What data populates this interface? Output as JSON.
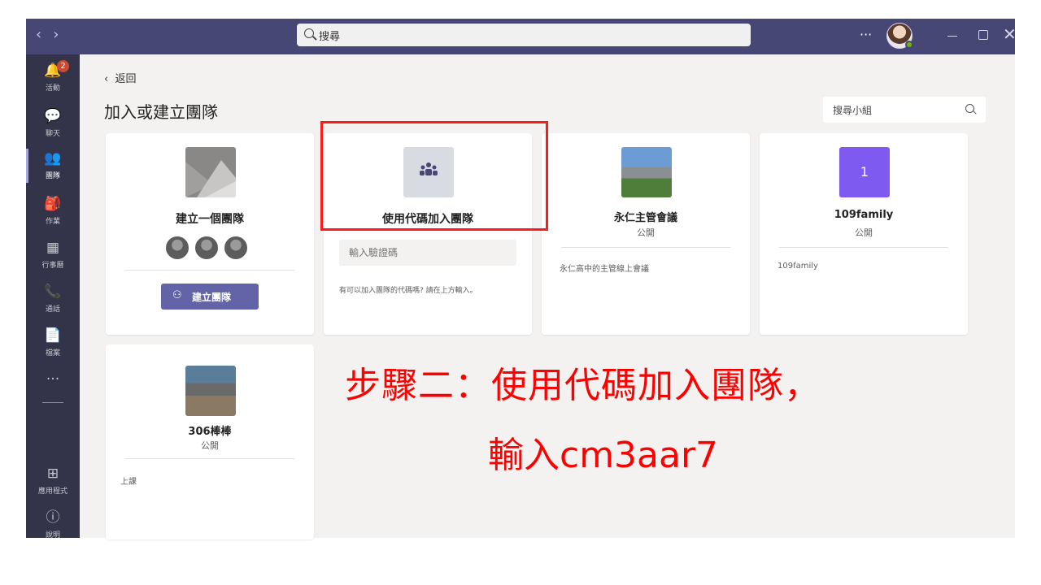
{
  "titlebar": {
    "search_text": "搜尋",
    "more_label": "···"
  },
  "rail": {
    "items": [
      {
        "label": "活動",
        "icon": "bell-icon",
        "badge": "2"
      },
      {
        "label": "聊天",
        "icon": "chat-icon"
      },
      {
        "label": "團隊",
        "icon": "teams-icon",
        "active": true
      },
      {
        "label": "作業",
        "icon": "assignments-icon"
      },
      {
        "label": "行事曆",
        "icon": "calendar-icon"
      },
      {
        "label": "通話",
        "icon": "phone-icon"
      },
      {
        "label": "檔案",
        "icon": "file-icon"
      }
    ],
    "more_label": "···",
    "apps_label": "應用程式",
    "help_label": "說明"
  },
  "page": {
    "back_label": "返回",
    "title": "加入或建立團隊",
    "group_search_placeholder": "搜尋小組"
  },
  "cards": {
    "create": {
      "title": "建立一個團隊",
      "button_label": "建立團隊"
    },
    "join_code": {
      "title": "使用代碼加入團隊",
      "input_placeholder": "輸入驗證碼",
      "hint": "有可以加入團隊的代碼嗎? 請在上方輸入。"
    },
    "team1": {
      "title": "永仁主管會議",
      "visibility": "公開",
      "description": "永仁高中的主管線上會議"
    },
    "team2": {
      "title": "109family",
      "visibility": "公開",
      "description": "109family",
      "avatar_letter": "1"
    },
    "team3": {
      "title": "306棒棒",
      "visibility": "公開",
      "description": "上課"
    }
  },
  "annotation": {
    "line1": "步驟二：使用代碼加入團隊，",
    "line2": "輸入cm3aar7",
    "color": "#ff0000"
  },
  "colors": {
    "titlebar": "#464775",
    "rail": "#33344a",
    "accent": "#6264a7",
    "highlight": "#ff1a1a"
  }
}
